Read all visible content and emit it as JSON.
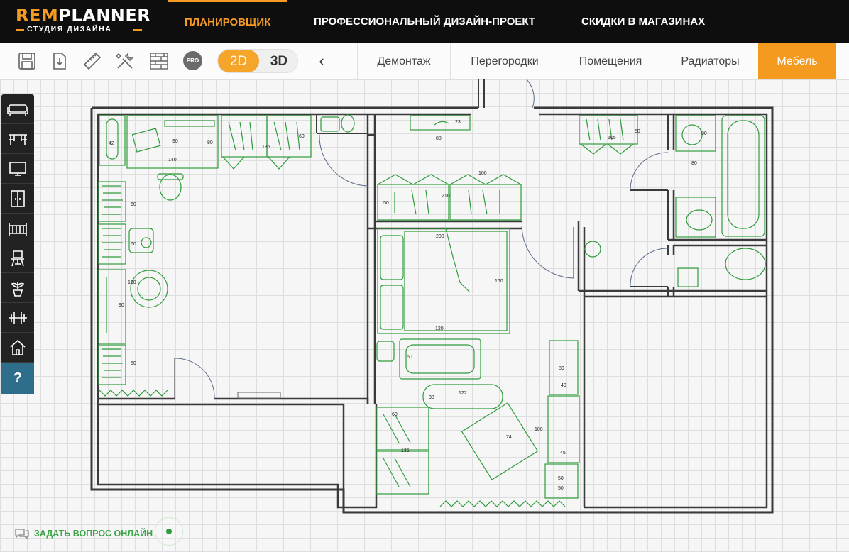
{
  "logo": {
    "main_part1": "REM",
    "main_part2": "PLANNER",
    "sub": "СТУДИЯ ДИЗАЙНА"
  },
  "topnav": {
    "planner": "ПЛАНИРОВЩИК",
    "design_project": "ПРОФЕССИОНАЛЬНЫЙ ДИЗАЙН-ПРОЕКТ",
    "discounts": "СКИДКИ В МАГАЗИНАХ"
  },
  "toolbar": {
    "tools": [
      "save-icon",
      "download-icon",
      "ruler-icon",
      "tools-icon",
      "bricks-icon"
    ],
    "pro": "PRO",
    "view_2d": "2D",
    "view_3d": "3D",
    "back": "‹"
  },
  "tabs": [
    "Демонтаж",
    "Перегородки",
    "Помещения",
    "Радиаторы",
    "Мебель"
  ],
  "active_tab": "Мебель",
  "sidebar": {
    "items": [
      "sofa-icon",
      "table-icon",
      "tv-icon",
      "wardrobe-icon",
      "crib-icon",
      "chair-icon",
      "plant-icon",
      "dumbbell-icon",
      "house-icon"
    ],
    "help": "?"
  },
  "dimensions": {
    "d42": "42",
    "d90": "90",
    "d80a": "80",
    "d140": "140",
    "d135a": "135",
    "d60a": "60",
    "d23": "23",
    "d88": "88",
    "d105": "105",
    "d50a": "50",
    "d80b": "80",
    "d100a": "100",
    "d210": "210",
    "d50b": "50",
    "d80c": "80",
    "d60b": "60",
    "d160a": "160",
    "d90b": "90",
    "d60c": "60",
    "d200": "200",
    "d160b": "160",
    "d120": "120",
    "d60d": "60",
    "d80d": "80",
    "d40": "40",
    "d38": "38",
    "d122": "122",
    "d60e": "60",
    "d135b": "135",
    "d74": "74",
    "d100b": "100",
    "d45": "45",
    "d50c": "50",
    "d50d": "50"
  },
  "chat": {
    "label": "ЗАДАТЬ ВОПРОС ОНЛАЙН"
  },
  "colors": {
    "accent": "#f39a1f",
    "furniture": "#2e9c3b",
    "walls": "#3a3a3a",
    "topbar": "#0e0e0e",
    "help": "#2f6e8a"
  }
}
